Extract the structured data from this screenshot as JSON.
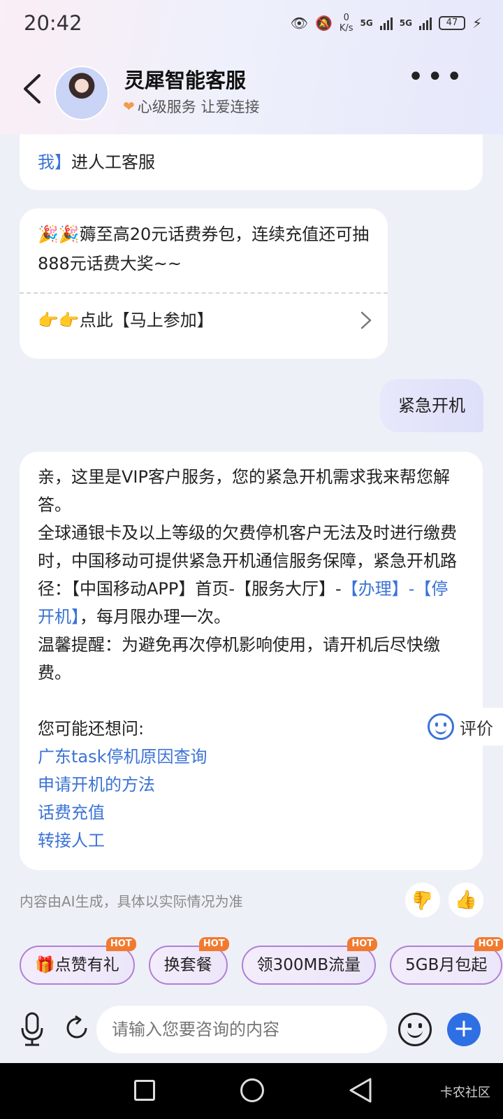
{
  "status_bar": {
    "time": "20:42",
    "net_speed_value": "0",
    "net_speed_unit": "K/s",
    "sig1": "5G",
    "sig2": "5G",
    "battery": "47"
  },
  "header": {
    "title": "灵犀智能客服",
    "subtitle": "心级服务 让爱连接"
  },
  "messages": {
    "bot1_prefix": "我】",
    "bot1_text": "进人工客服",
    "bot2_text": "🎉🎉薅至高20元话费券包，连续充值还可抽888元话费大奖~~",
    "bot2_join": "👉👉点此【马上参加】",
    "user_text": "紧急开机",
    "bot3_p1": "亲，这里是VIP客户服务，您的紧急开机需求我来帮您解答。",
    "bot3_p2_a": "全球通银卡及以上等级的欠费停机客户无法及时进行缴费时，中国移动可提供紧急开机通信服务保障，紧急开机路径：【中国移动APP】首页-【服务大厅】-",
    "bot3_link1": "【办理】",
    "bot3_sep": "-",
    "bot3_link2": "【停开机】",
    "bot3_p2_b": "，每月限办理一次。",
    "bot3_p3": "温馨提醒：为避免再次停机影响使用，请开机后尽快缴费。",
    "suggest_title": "您可能还想问:",
    "suggestions": [
      "广东task停机原因查询",
      "申请开机的方法",
      "话费充值",
      "转接人工"
    ]
  },
  "rate_label": "评价",
  "disclaimer": "内容由AI生成，具体以实际情况为准",
  "chips": [
    {
      "label": "🎁点赞有礼",
      "badge": "HOT"
    },
    {
      "label": "换套餐",
      "badge": "HOT"
    },
    {
      "label": "领300MB流量",
      "badge": "HOT"
    },
    {
      "label": "5GB月包起",
      "badge": "HOT"
    }
  ],
  "input": {
    "placeholder": "请输入您要咨询的内容"
  },
  "watermark": "卡农社区",
  "colors": {
    "link": "#3b73d6",
    "accent": "#2f6fe4",
    "hot": "#f27a2f"
  }
}
